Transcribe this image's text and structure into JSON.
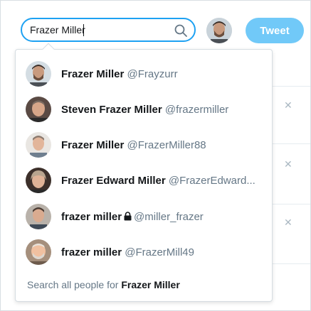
{
  "search": {
    "value": "Frazer Miller"
  },
  "header": {
    "tweet_label": "Tweet"
  },
  "results": [
    {
      "name": "Frazer Miller",
      "handle": "@Frayzurr",
      "locked": false,
      "avatar": "avatar-man-1"
    },
    {
      "name": "Steven Frazer Miller",
      "handle": "@frazermiller",
      "locked": false,
      "avatar": "avatar-man-2"
    },
    {
      "name": "Frazer Miller",
      "handle": "@FrazerMiller88",
      "locked": false,
      "avatar": "avatar-man-3"
    },
    {
      "name": "Frazer Edward Miller",
      "handle": "@FrazerEdward...",
      "locked": false,
      "avatar": "avatar-woman-1"
    },
    {
      "name": "frazer miller",
      "handle": "@miller_frazer",
      "locked": true,
      "avatar": "avatar-man-4"
    },
    {
      "name": "frazer miller",
      "handle": "@FrazerMill49",
      "locked": false,
      "avatar": "avatar-man-5"
    }
  ],
  "search_all": {
    "prefix": "Search all people for ",
    "query": "Frazer Miller"
  },
  "colors": {
    "accent": "#1da1f2",
    "tweet_button": "#71c9f8",
    "text": "#14171a",
    "muted": "#657786"
  }
}
